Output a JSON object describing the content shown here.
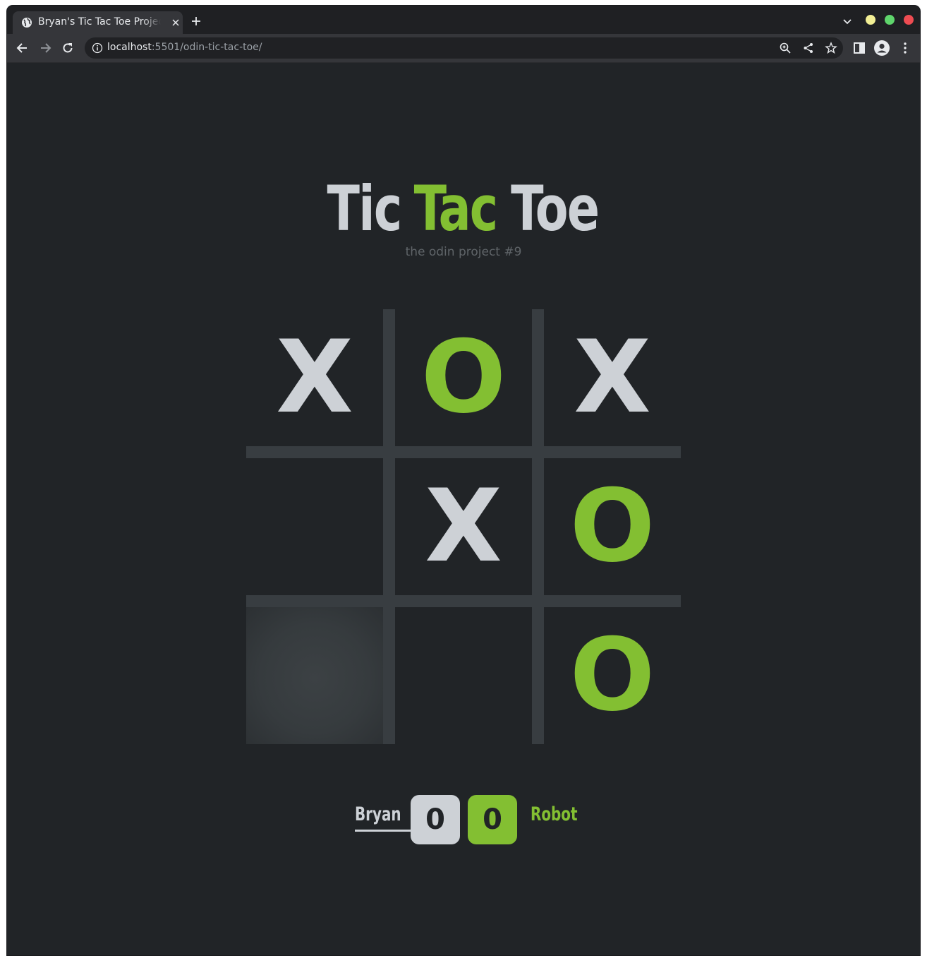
{
  "browser": {
    "tab_title": "Bryan's Tic Tac Toe Project",
    "url_host": "localhost",
    "url_rest": ":5501/odin-tic-tac-toe/"
  },
  "header": {
    "title_part1": "Tic",
    "title_part2": "Tac",
    "title_part3": "Toe",
    "subtitle": "the odin project #9"
  },
  "board": {
    "cells": [
      "X",
      "O",
      "X",
      "",
      "X",
      "O",
      "",
      "",
      "O"
    ]
  },
  "scoreboard": {
    "player1_name": "Bryan",
    "player1_score": "0",
    "player2_name": "Robot",
    "player2_score": "0"
  },
  "colors": {
    "background": "#212427",
    "x_mark": "#cdd1d6",
    "o_mark": "#83bf32",
    "grid": "#383d41"
  }
}
